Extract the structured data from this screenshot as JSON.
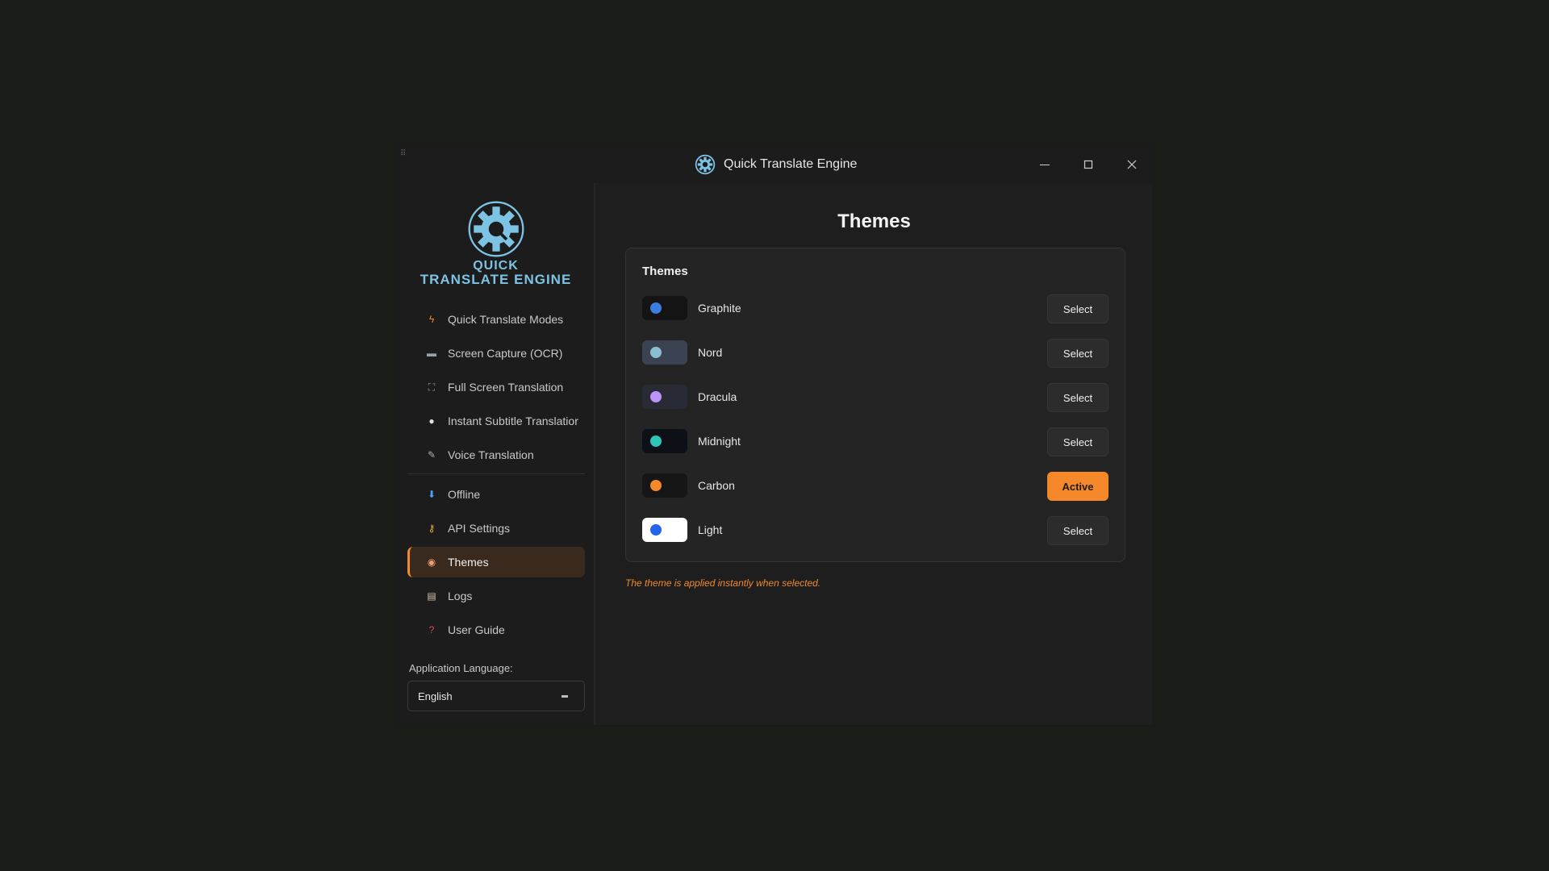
{
  "window": {
    "title": "Quick Translate Engine",
    "controls": {
      "minimize_icon": "minimize-icon",
      "maximize_icon": "maximize-icon",
      "close_icon": "close-icon"
    }
  },
  "sidebar": {
    "logo": {
      "line1": "QUICK",
      "line2": "TRANSLATE ENGINE"
    },
    "items": [
      {
        "label": "Quick Translate Modes",
        "icon": "lightning-icon"
      },
      {
        "label": "Screen Capture (OCR)",
        "icon": "keyboard-icon"
      },
      {
        "label": "Full Screen Translation",
        "icon": "fullscreen-icon"
      },
      {
        "label": "Instant Subtitle Translatior",
        "icon": "speech-bubble-icon"
      },
      {
        "label": "Voice Translation",
        "icon": "microphone-icon"
      },
      {
        "label": "Offline",
        "icon": "download-icon"
      },
      {
        "label": "API Settings",
        "icon": "key-icon"
      },
      {
        "label": "Themes",
        "icon": "palette-icon",
        "active": true
      },
      {
        "label": "Logs",
        "icon": "clipboard-icon"
      },
      {
        "label": "User Guide",
        "icon": "question-icon"
      }
    ],
    "language_label": "Application Language:",
    "language_value": "English"
  },
  "main": {
    "title": "Themes",
    "card_title": "Themes",
    "themes": [
      {
        "name": "Graphite",
        "button": "Select",
        "swatch_bg": "#141414",
        "dot": "#3b7de0"
      },
      {
        "name": "Nord",
        "button": "Select",
        "swatch_bg": "#3b4252",
        "dot": "#88c0d0"
      },
      {
        "name": "Dracula",
        "button": "Select",
        "swatch_bg": "#282a36",
        "dot": "#bd93f9"
      },
      {
        "name": "Midnight",
        "button": "Select",
        "swatch_bg": "#0d1117",
        "dot": "#2ec4b6"
      },
      {
        "name": "Carbon",
        "button": "Active",
        "swatch_bg": "#161616",
        "dot": "#f5892a",
        "active": true
      },
      {
        "name": "Light",
        "button": "Select",
        "swatch_bg": "#ffffff",
        "dot": "#2563eb"
      }
    ],
    "hint": "The theme is applied instantly when selected."
  },
  "colors": {
    "accent": "#f5892a",
    "logo": "#7dc4e4",
    "background": "#1e1e1e"
  }
}
